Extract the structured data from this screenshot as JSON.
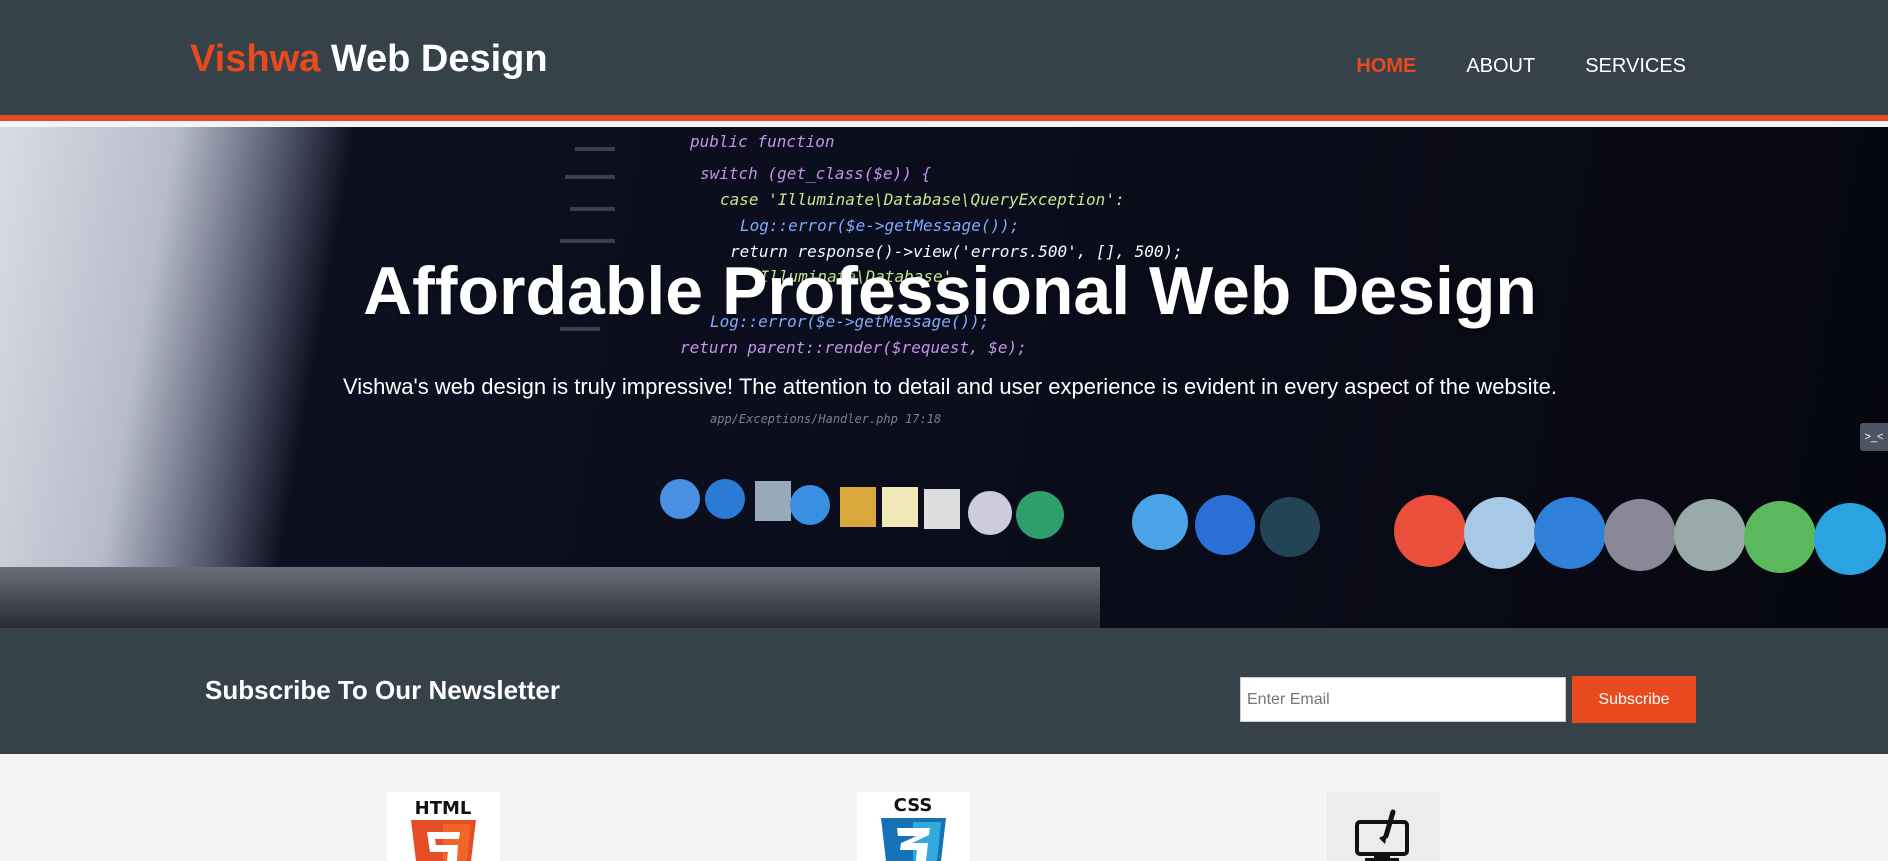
{
  "branding": {
    "highlight": "Vishwa",
    "rest": " Web Design"
  },
  "nav": {
    "items": [
      {
        "label": "HOME",
        "current": true
      },
      {
        "label": "ABOUT",
        "current": false
      },
      {
        "label": "SERVICES",
        "current": false
      }
    ]
  },
  "showcase": {
    "title": "Affordable Professional Web Design",
    "text": "Vishwa's web design is truly impressive! The attention to detail and user experience is evident in every aspect of the website.",
    "side_tab": ">_<"
  },
  "newsletter": {
    "title": "Subscribe To Our Newsletter",
    "email_placeholder": "Enter Email",
    "subscribe_label": "Subscribe"
  },
  "boxes": [
    {
      "icon": "html5-icon",
      "label": "HTML"
    },
    {
      "icon": "css3-icon",
      "label": "CSS"
    },
    {
      "icon": "monitor-brush-icon"
    }
  ],
  "colors": {
    "accent": "#e8491d",
    "dark": "#35424a",
    "light": "#f4f4f4"
  }
}
